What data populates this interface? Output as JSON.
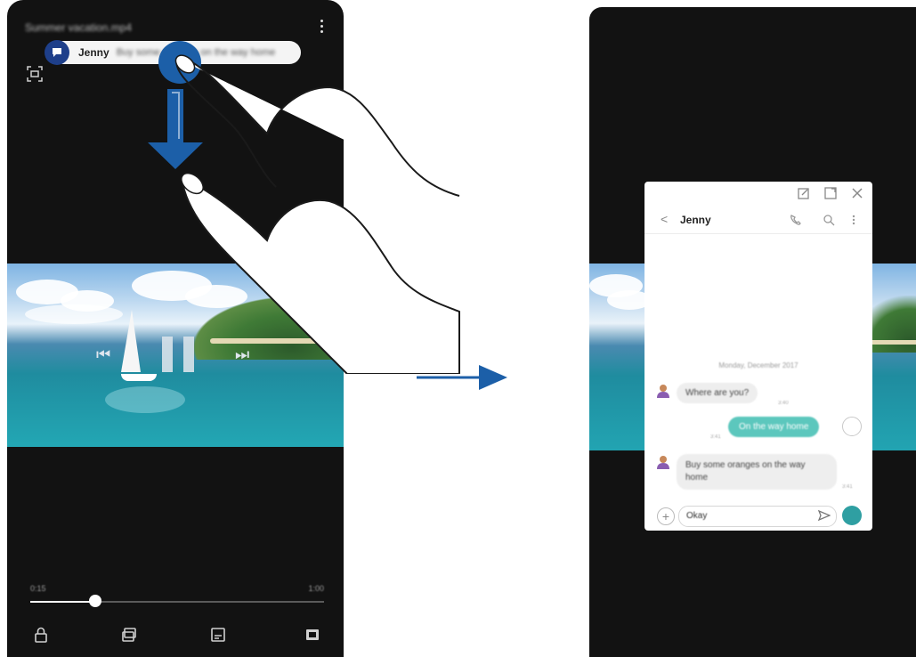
{
  "left_screen": {
    "video_title": "Summer vacation.mp4",
    "notification": {
      "sender": "Jenny",
      "preview": "Buy some oranges on the way home"
    },
    "controls": {
      "prev_glyph": "⏮",
      "next_glyph": "⏭"
    },
    "seek": {
      "current_time": "0:15",
      "total_time": "1:00",
      "progress": 0.22
    },
    "icons": [
      "more-icon",
      "capture-icon",
      "lock-icon",
      "popup-play-icon",
      "subtitle-icon",
      "fullscreen-icon"
    ]
  },
  "right_screen": {
    "popup": {
      "contact_name": "Jenny",
      "back_glyph": "<",
      "date_separator": "Monday, December 2017",
      "messages": [
        {
          "direction": "in",
          "text": "Where are you?",
          "time": "3:40"
        },
        {
          "direction": "out",
          "text": "On the way home",
          "time": "3:41"
        },
        {
          "direction": "in",
          "text": "Buy some oranges on the way home",
          "time": "3:41"
        }
      ],
      "input_value": "Okay",
      "add_glyph": "+"
    }
  },
  "colors": {
    "notification_accent": "#1e3f8a",
    "gesture_arrow": "#1c5fa8",
    "outgoing_bubble": "#5cc7bd"
  }
}
